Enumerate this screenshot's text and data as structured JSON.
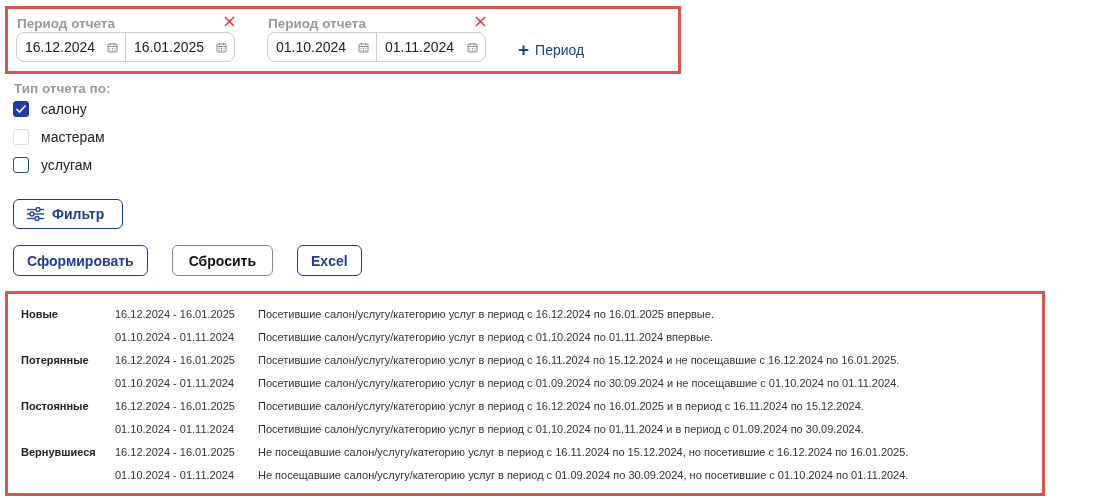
{
  "periods": [
    {
      "label": "Период отчета",
      "from": "16.12.2024",
      "to": "16.01.2025"
    },
    {
      "label": "Период отчета",
      "from": "01.10.2024",
      "to": "01.11.2024"
    }
  ],
  "add_period": {
    "icon": "+",
    "label": "Период"
  },
  "report_type": {
    "label": "Тип отчета по:",
    "options": [
      {
        "label": "салону",
        "checked": true,
        "disabled": false
      },
      {
        "label": "мастерам",
        "checked": false,
        "disabled": true
      },
      {
        "label": "услугам",
        "checked": false,
        "disabled": false
      }
    ]
  },
  "filter_button": "Фильтр",
  "buttons": [
    {
      "label": "Сформировать",
      "kind": "primary"
    },
    {
      "label": "Сбросить",
      "kind": "neutral"
    },
    {
      "label": "Excel",
      "kind": "primary"
    }
  ],
  "legend": [
    {
      "category": "Новые",
      "entries": [
        {
          "period": "16.12.2024 - 16.01.2025",
          "description": "Посетившие салон/услугу/категорию услуг в период с 16.12.2024 по 16.01.2025 впервые."
        },
        {
          "period": "01.10.2024 - 01.11.2024",
          "description": "Посетившие салон/услугу/категорию услуг в период с 01.10.2024 по 01.11.2024 впервые."
        }
      ]
    },
    {
      "category": "Потерянные",
      "entries": [
        {
          "period": "16.12.2024 - 16.01.2025",
          "description": "Посетившие салон/услугу/категорию услуг в период с 16.11.2024 по 15.12.2024 и не посещавшие с 16.12.2024 по 16.01.2025."
        },
        {
          "period": "01.10.2024 - 01.11.2024",
          "description": "Посетившие салон/услугу/категорию услуг в период с 01.09.2024 по 30.09.2024 и не посещавшие с 01.10.2024 по 01.11.2024."
        }
      ]
    },
    {
      "category": "Постоянные",
      "entries": [
        {
          "period": "16.12.2024 - 16.01.2025",
          "description": "Посетившие салон/услугу/категорию услуг в период с 16.12.2024 по 16.01.2025 и в период с 16.11.2024 по 15.12.2024."
        },
        {
          "period": "01.10.2024 - 01.11.2024",
          "description": "Посетившие салон/услугу/категорию услуг в период с 01.10.2024 по 01.11.2024 и в период с 01.09.2024 по 30.09.2024."
        }
      ]
    },
    {
      "category": "Вернувшиеся",
      "entries": [
        {
          "period": "16.12.2024 - 16.01.2025",
          "description": "Не посещавшие салон/услугу/категорию услуг в период с 16.11.2024 по 15.12.2024, но посетившие с 16.12.2024 по 16.01.2025."
        },
        {
          "period": "01.10.2024 - 01.11.2024",
          "description": "Не посещавшие салон/услугу/категорию услуг в период с 01.09.2024 по 30.09.2024, но посетившие с 01.10.2024 по 01.11.2024."
        }
      ]
    }
  ]
}
